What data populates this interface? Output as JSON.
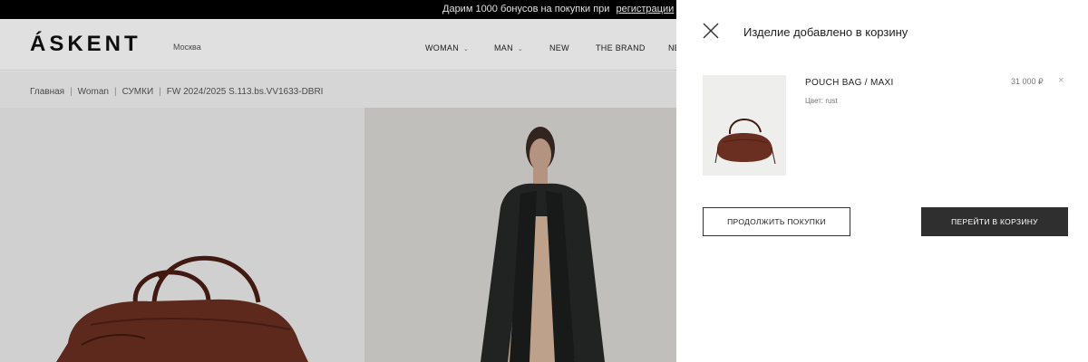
{
  "promo": {
    "text": "Дарим 1000 бонусов на покупки при",
    "link": "регистрации"
  },
  "header": {
    "logo": "ÁSKENT",
    "city": "Москва",
    "nav": [
      {
        "label": "WOMAN",
        "chevron": true
      },
      {
        "label": "MAN",
        "chevron": true
      },
      {
        "label": "NEW",
        "chevron": false
      },
      {
        "label": "THE BRAND",
        "chevron": false
      },
      {
        "label": "NE",
        "chevron": false
      }
    ]
  },
  "breadcrumbs": [
    "Главная",
    "Woman",
    "СУМКИ",
    "FW 2024/2025 S.113.bs.VV1633-DBRI"
  ],
  "drawer": {
    "title": "Изделие добавлено в корзину",
    "item": {
      "name": "POUCH BAG / MAXI",
      "color_label": "Цвет:",
      "color_value": "rust",
      "price": "31 000 ₽",
      "remove_icon": "×"
    },
    "continue_label": "ПРОДОЛЖИТЬ ПОКУПКИ",
    "cart_label": "ПЕРЕЙТИ В КОРЗИНУ"
  },
  "colors": {
    "bag": "#6b2f22",
    "dark_button": "#2f2f2f",
    "promo_bar": "#000000"
  }
}
